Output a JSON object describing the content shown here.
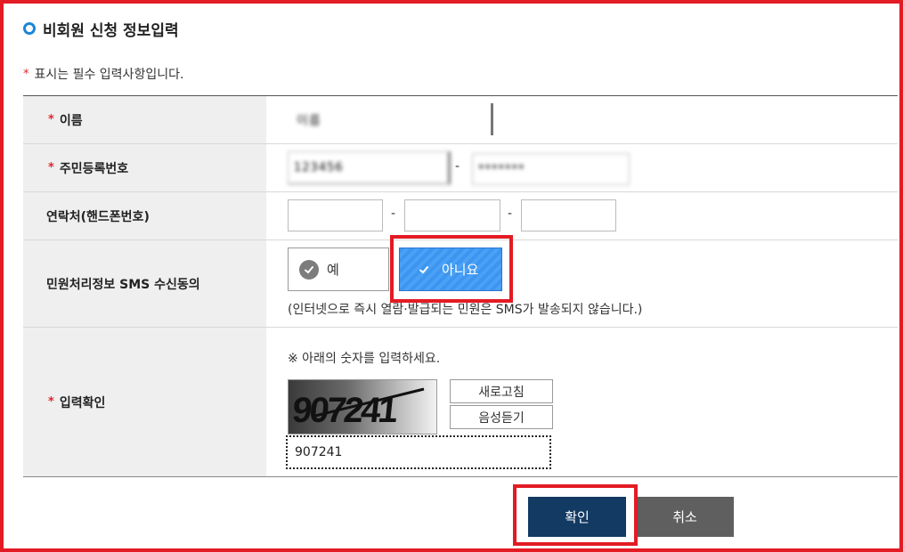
{
  "section": {
    "title": "비회원 신청 정보입력",
    "icon": "circle-icon"
  },
  "required_note": {
    "star": "*",
    "text": "표시는 필수 입력사항입니다."
  },
  "form": {
    "name": {
      "label": "이름",
      "value": "이름"
    },
    "rrn": {
      "label": "주민등록번호",
      "front_value": "123456",
      "dash": "-",
      "back_value": "*******"
    },
    "phone": {
      "label": "연락처(핸드폰번호)",
      "dash": "-",
      "part1": "",
      "part2": "",
      "part3": ""
    },
    "sms": {
      "label": "민원처리정보 SMS 수신동의",
      "yes_label": "예",
      "no_label": "아니요",
      "selected": "no",
      "note": "(인터넷으로 즉시 열람·발급되는 민원은 SMS가 발송되지 않습니다.)"
    },
    "captcha": {
      "label": "입력확인",
      "guide": "※ 아래의 숫자를 입력하세요.",
      "image_text": "907241",
      "refresh_label": "새로고침",
      "audio_label": "음성듣기",
      "input_value": "907241"
    }
  },
  "actions": {
    "confirm_label": "확인",
    "cancel_label": "취소"
  },
  "colors": {
    "highlight": "#e31b23",
    "primary": "#123a62",
    "selected": "#3d95ef",
    "required_star": "#e0242c"
  }
}
